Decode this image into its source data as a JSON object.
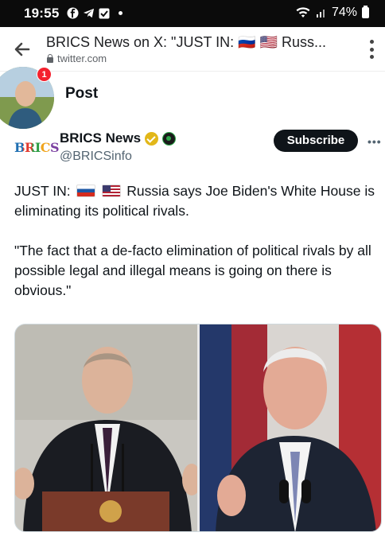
{
  "status_bar": {
    "time": "19:55",
    "battery": "74%"
  },
  "browser": {
    "title": "BRICS News on X: \"JUST IN: 🇷🇺 🇺🇸 Russ...",
    "url": "twitter.com"
  },
  "post_page": {
    "heading": "Post",
    "notification_count": "1"
  },
  "account": {
    "logo_text": "BRICS",
    "name": "BRICS News",
    "handle": "@BRICSinfo",
    "subscribe_label": "Subscribe"
  },
  "tweet": {
    "line1_prefix": "JUST IN:",
    "line1_rest": "Russia says Joe Biden's White House is eliminating its political rivals.",
    "quote": "\"The fact that a de-facto elimination of political rivals by all possible legal and illegal means is going on there is obvious.\""
  },
  "colors": {
    "text": "#0f1419",
    "muted": "#536471",
    "verified_gold": "#e2b719",
    "notification_red": "#f4212e"
  },
  "icons": [
    "back-arrow-icon",
    "lock-icon",
    "kebab-menu-icon",
    "verified-badge-icon",
    "affiliation-badge-icon",
    "more-options-icon",
    "wifi-icon",
    "signal-icon",
    "battery-icon"
  ]
}
